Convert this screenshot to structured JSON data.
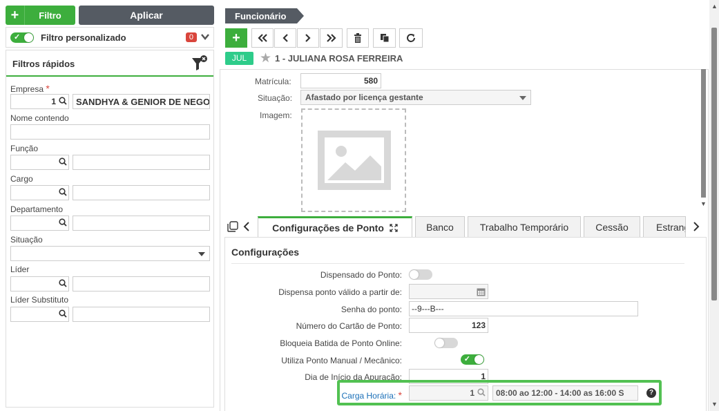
{
  "left": {
    "filtro_label": "Filtro",
    "aplicar_label": "Aplicar",
    "filtro_personalizado": "Filtro personalizado",
    "filtro_count": "0",
    "filtros_rapidos": "Filtros rápidos",
    "empresa_label": "Empresa",
    "empresa_code": "1",
    "empresa_name": "SANDHYA & GENIOR DE NEGOCIOS",
    "nome_label": "Nome contendo",
    "funcao_label": "Função",
    "cargo_label": "Cargo",
    "departamento_label": "Departamento",
    "situacao_label": "Situação",
    "lider_label": "Líder",
    "lider_subst_label": "Líder Substituto"
  },
  "header": {
    "tab_title": "Funcionário",
    "month_badge": "JUL",
    "employee": "1 - JULIANA ROSA FERREIRA"
  },
  "form": {
    "matricula_label": "Matrícula:",
    "matricula_value": "580",
    "situacao_label": "Situação:",
    "situacao_value": "Afastado por licença gestante",
    "imagem_label": "Imagem:"
  },
  "tabs": [
    "Configurações de Ponto",
    "Banco",
    "Trabalho Temporário",
    "Cessão",
    "Estrangeiro"
  ],
  "config": {
    "title": "Configurações",
    "dispensado_label": "Dispensado do Ponto:",
    "dispensa_valido_label": "Dispensa ponto válido a partir de:",
    "senha_label": "Senha do ponto:",
    "senha_value": "--9---B---",
    "cartao_label": "Número do Cartão de Ponto:",
    "cartao_value": "123",
    "bloqueia_label": "Bloqueia Batida de Ponto Online:",
    "manual_label": "Utiliza Ponto Manual / Mecânico:",
    "dia_inicio_label": "Dia de Início da Apuração:",
    "dia_inicio_value": "1",
    "carga_label": "Carga Horária:",
    "carga_code": "1",
    "carga_desc": "08:00 ao 12:00 - 14:00 as 16:00 S"
  },
  "colors": {
    "green": "#3dae3d",
    "dark": "#555b63",
    "badge_red": "#d9453c",
    "jul_green": "#2ecc8a"
  }
}
